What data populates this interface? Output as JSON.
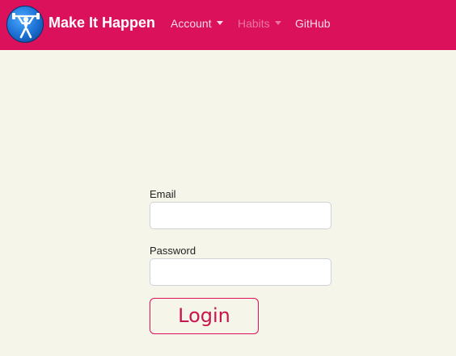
{
  "navbar": {
    "brand": "Make It Happen",
    "background": "#db115b",
    "items": [
      {
        "label": "Account",
        "dropdown": true,
        "disabled": false
      },
      {
        "label": "Habits",
        "dropdown": true,
        "disabled": true
      },
      {
        "label": "GitHub",
        "dropdown": false,
        "disabled": false
      }
    ]
  },
  "form": {
    "email_label": "Email",
    "email_value": "",
    "password_label": "Password",
    "password_value": "",
    "login_label": "Login"
  },
  "colors": {
    "accent": "#db115b",
    "page_background": "#f5f5ea"
  },
  "icons": {
    "logo": "weightlifter-icon",
    "dropdown": "caret-down-icon"
  }
}
